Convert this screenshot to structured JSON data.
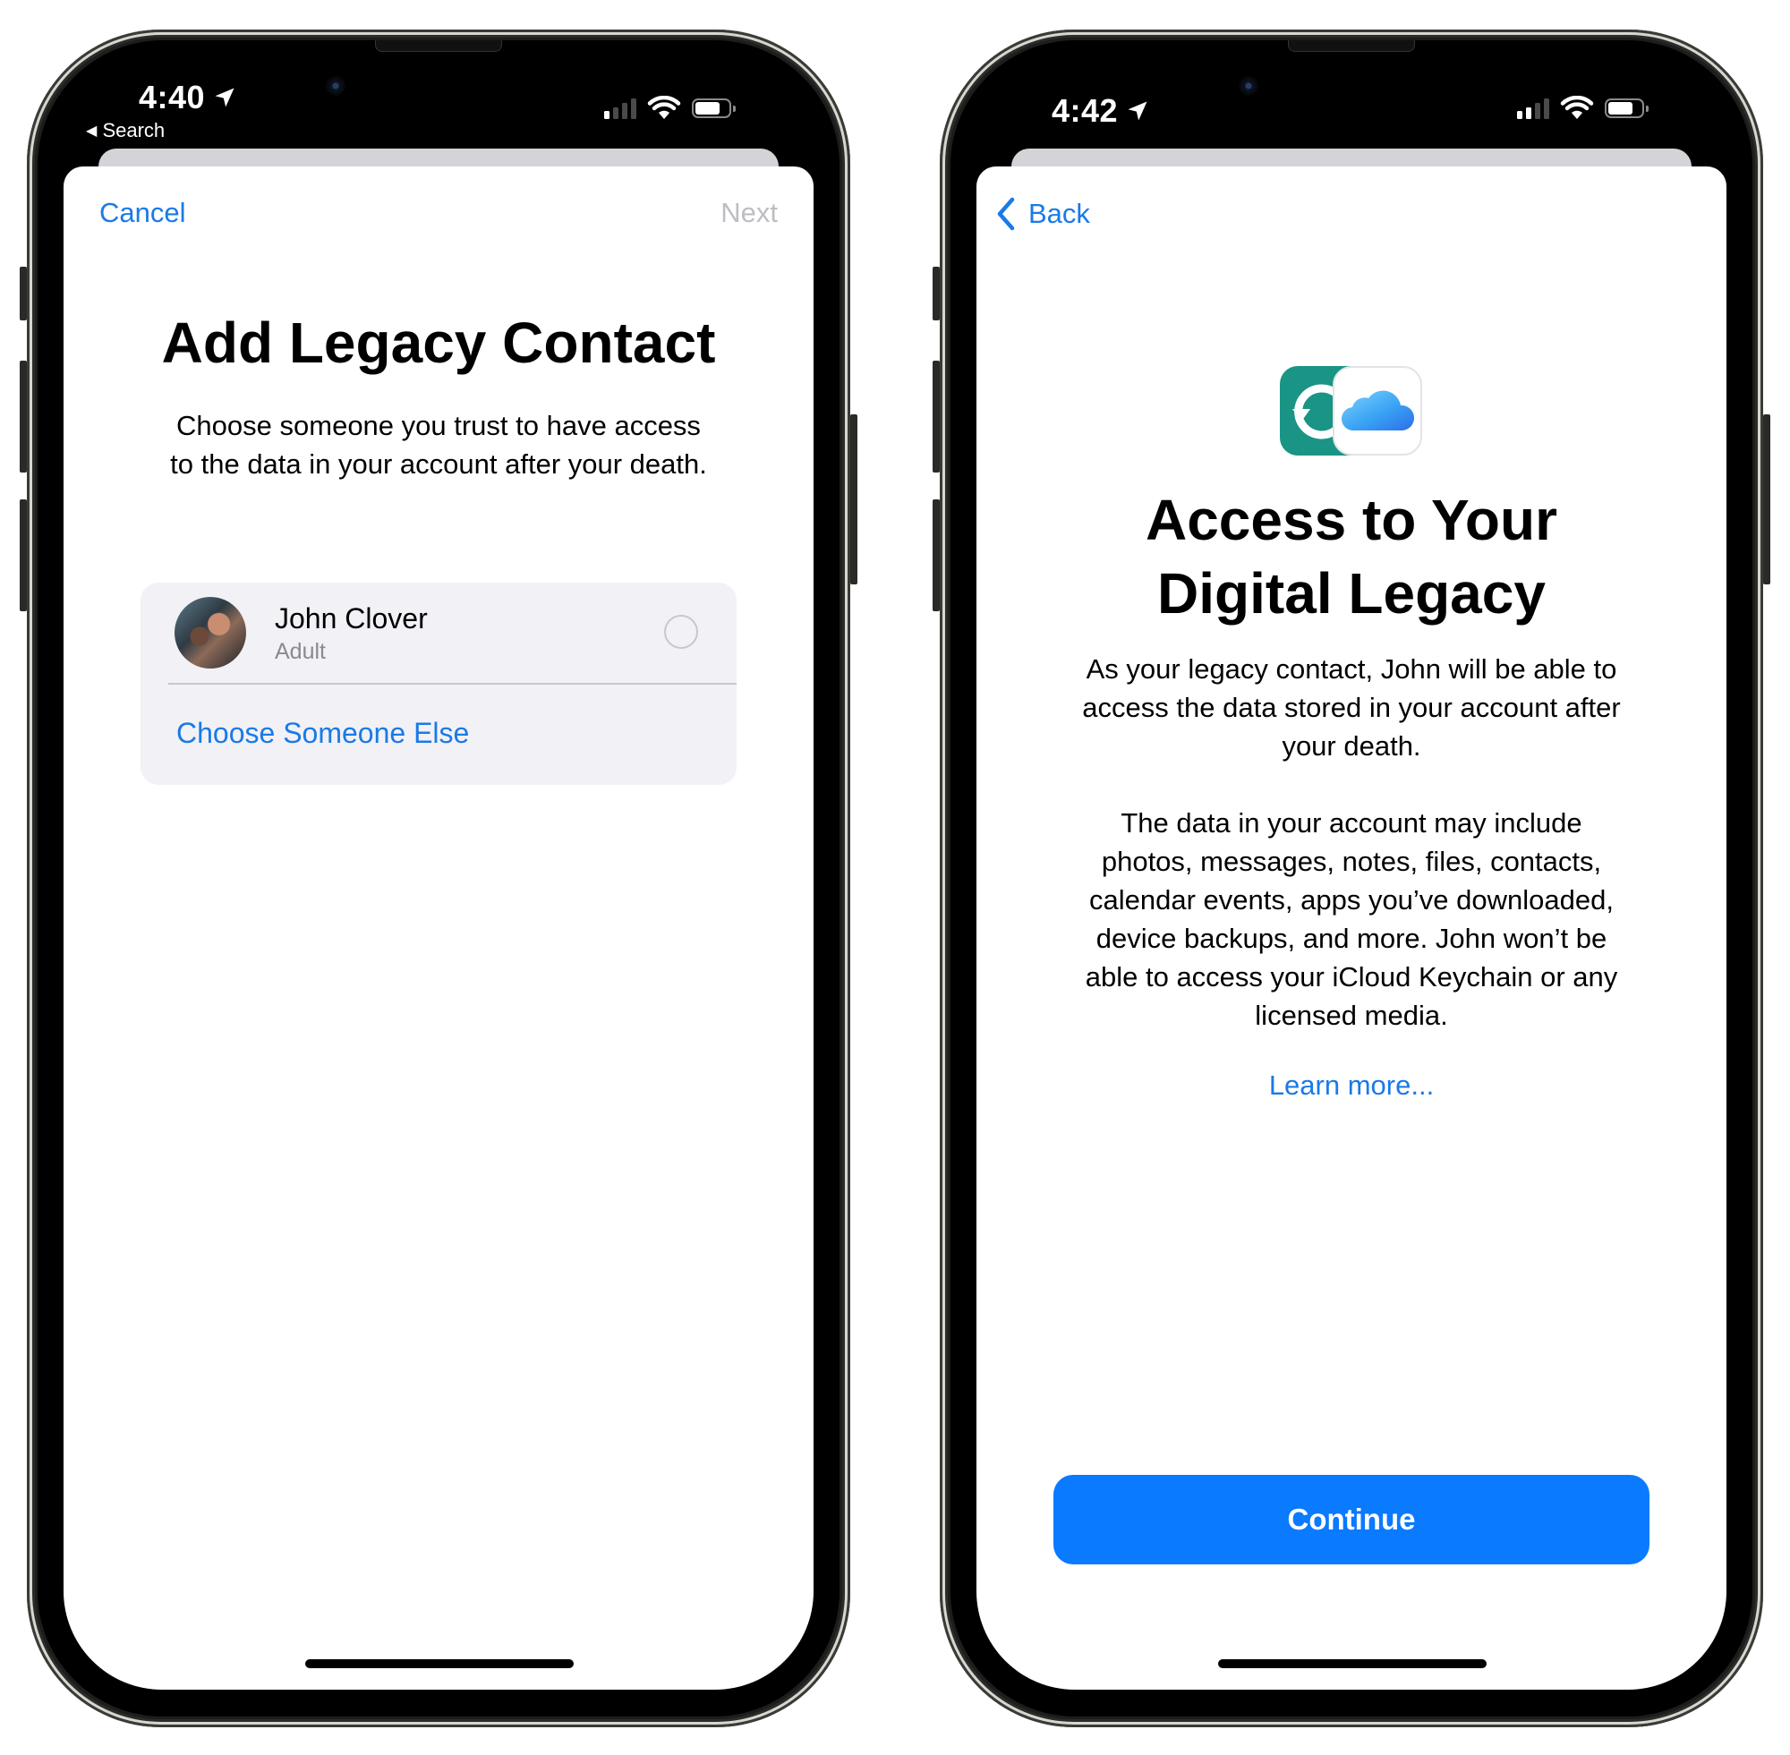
{
  "screens": [
    {
      "status_bar": {
        "time": "4:40",
        "breadcrumb": "Search",
        "location_icon": "location-arrow-icon",
        "signal_bars_active": 1,
        "signal_bars_total": 4,
        "battery_level": 0.75
      },
      "nav": {
        "left_label": "Cancel",
        "right_label": "Next",
        "right_enabled": false
      },
      "title": "Add Legacy Contact",
      "subtitle_lines": [
        "Choose someone you trust to have access",
        "to the data in your account after your death."
      ],
      "contact_card": {
        "contact": {
          "name": "John Clover",
          "role": "Adult",
          "selected": false
        },
        "alt_action": "Choose Someone Else"
      }
    },
    {
      "status_bar": {
        "time": "4:42",
        "location_icon": "location-arrow-icon",
        "signal_bars_active": 2,
        "signal_bars_total": 4,
        "battery_level": 0.75
      },
      "nav": {
        "back_label": "Back"
      },
      "icons": [
        "backup-restore-icon",
        "icloud-icon"
      ],
      "title_lines": [
        "Access to Your",
        "Digital Legacy"
      ],
      "paragraph1_lines": [
        "As your legacy contact, John will be able to",
        "access the data stored in your account after",
        "your death."
      ],
      "paragraph2_lines": [
        "The data in your account may include",
        "photos, messages, notes, files, contacts,",
        "calendar events, apps you’ve downloaded,",
        "device backups, and more. John won’t be",
        "able to access your iCloud Keychain or any",
        "licensed media."
      ],
      "learn_more": "Learn more...",
      "continue_label": "Continue"
    }
  ],
  "colors": {
    "accent": "#1a7ae6",
    "primary_button": "#0a7aff",
    "disabled_text": "#bdbdc2",
    "card_bg": "#f1f1f6",
    "backup_icon_bg": "#1a9485"
  }
}
